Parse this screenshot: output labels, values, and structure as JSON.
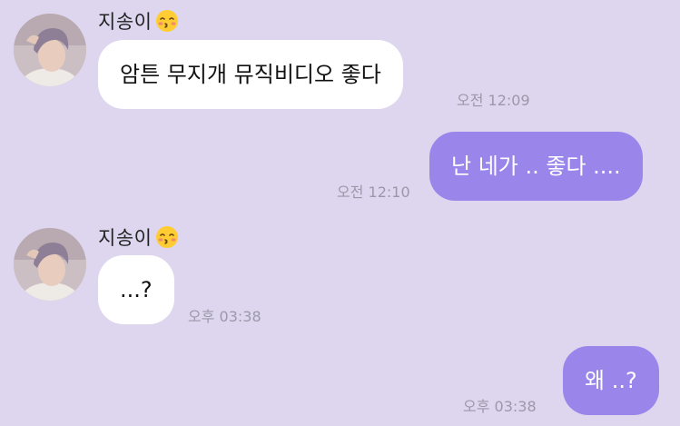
{
  "contact": {
    "name": "지송이",
    "name_emoji": "kissing-face-closed-eyes-emoji"
  },
  "messages": [
    {
      "sender": "contact",
      "text": "암튼 무지개 뮤직비디오 좋다",
      "time": "오전 12:09"
    },
    {
      "sender": "me",
      "text": "난 네가 .. 좋다 ....",
      "time": "오전 12:10"
    },
    {
      "sender": "contact",
      "text": "...?",
      "time": "오후 03:38"
    },
    {
      "sender": "me",
      "text": "왜 ..?",
      "time": "오후 03:38"
    }
  ],
  "colors": {
    "background": "#ddd6ee",
    "incoming_bubble": "#ffffff",
    "outgoing_bubble": "#9a86ea",
    "timestamp": "#9d98a9"
  }
}
